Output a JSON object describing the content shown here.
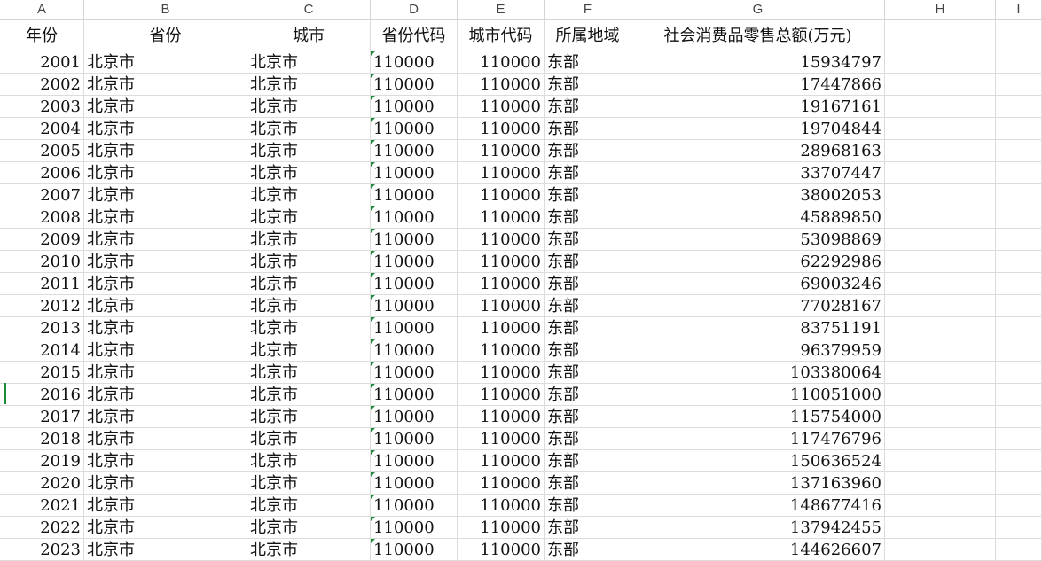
{
  "columns": [
    "A",
    "B",
    "C",
    "D",
    "E",
    "F",
    "G",
    "H",
    "I"
  ],
  "header": {
    "year": "年份",
    "province": "省份",
    "city": "城市",
    "province_code": "省份代码",
    "city_code": "城市代码",
    "region": "所属地域",
    "retail_sales": "社会消费品零售总额(万元)"
  },
  "rows": [
    {
      "year": "2001",
      "province": "北京市",
      "city": "北京市",
      "province_code": "110000",
      "city_code": "110000",
      "region": "东部",
      "retail_sales": "15934797"
    },
    {
      "year": "2002",
      "province": "北京市",
      "city": "北京市",
      "province_code": "110000",
      "city_code": "110000",
      "region": "东部",
      "retail_sales": "17447866"
    },
    {
      "year": "2003",
      "province": "北京市",
      "city": "北京市",
      "province_code": "110000",
      "city_code": "110000",
      "region": "东部",
      "retail_sales": "19167161"
    },
    {
      "year": "2004",
      "province": "北京市",
      "city": "北京市",
      "province_code": "110000",
      "city_code": "110000",
      "region": "东部",
      "retail_sales": "19704844"
    },
    {
      "year": "2005",
      "province": "北京市",
      "city": "北京市",
      "province_code": "110000",
      "city_code": "110000",
      "region": "东部",
      "retail_sales": "28968163"
    },
    {
      "year": "2006",
      "province": "北京市",
      "city": "北京市",
      "province_code": "110000",
      "city_code": "110000",
      "region": "东部",
      "retail_sales": "33707447"
    },
    {
      "year": "2007",
      "province": "北京市",
      "city": "北京市",
      "province_code": "110000",
      "city_code": "110000",
      "region": "东部",
      "retail_sales": "38002053"
    },
    {
      "year": "2008",
      "province": "北京市",
      "city": "北京市",
      "province_code": "110000",
      "city_code": "110000",
      "region": "东部",
      "retail_sales": "45889850"
    },
    {
      "year": "2009",
      "province": "北京市",
      "city": "北京市",
      "province_code": "110000",
      "city_code": "110000",
      "region": "东部",
      "retail_sales": "53098869"
    },
    {
      "year": "2010",
      "province": "北京市",
      "city": "北京市",
      "province_code": "110000",
      "city_code": "110000",
      "region": "东部",
      "retail_sales": "62292986"
    },
    {
      "year": "2011",
      "province": "北京市",
      "city": "北京市",
      "province_code": "110000",
      "city_code": "110000",
      "region": "东部",
      "retail_sales": "69003246"
    },
    {
      "year": "2012",
      "province": "北京市",
      "city": "北京市",
      "province_code": "110000",
      "city_code": "110000",
      "region": "东部",
      "retail_sales": "77028167"
    },
    {
      "year": "2013",
      "province": "北京市",
      "city": "北京市",
      "province_code": "110000",
      "city_code": "110000",
      "region": "东部",
      "retail_sales": "83751191"
    },
    {
      "year": "2014",
      "province": "北京市",
      "city": "北京市",
      "province_code": "110000",
      "city_code": "110000",
      "region": "东部",
      "retail_sales": "96379959"
    },
    {
      "year": "2015",
      "province": "北京市",
      "city": "北京市",
      "province_code": "110000",
      "city_code": "110000",
      "region": "东部",
      "retail_sales": "103380064"
    },
    {
      "year": "2016",
      "province": "北京市",
      "city": "北京市",
      "province_code": "110000",
      "city_code": "110000",
      "region": "东部",
      "retail_sales": "110051000"
    },
    {
      "year": "2017",
      "province": "北京市",
      "city": "北京市",
      "province_code": "110000",
      "city_code": "110000",
      "region": "东部",
      "retail_sales": "115754000"
    },
    {
      "year": "2018",
      "province": "北京市",
      "city": "北京市",
      "province_code": "110000",
      "city_code": "110000",
      "region": "东部",
      "retail_sales": "117476796"
    },
    {
      "year": "2019",
      "province": "北京市",
      "city": "北京市",
      "province_code": "110000",
      "city_code": "110000",
      "region": "东部",
      "retail_sales": "150636524"
    },
    {
      "year": "2020",
      "province": "北京市",
      "city": "北京市",
      "province_code": "110000",
      "city_code": "110000",
      "region": "东部",
      "retail_sales": "137163960"
    },
    {
      "year": "2021",
      "province": "北京市",
      "city": "北京市",
      "province_code": "110000",
      "city_code": "110000",
      "region": "东部",
      "retail_sales": "148677416"
    },
    {
      "year": "2022",
      "province": "北京市",
      "city": "北京市",
      "province_code": "110000",
      "city_code": "110000",
      "region": "东部",
      "retail_sales": "137942455"
    },
    {
      "year": "2023",
      "province": "北京市",
      "city": "北京市",
      "province_code": "110000",
      "city_code": "110000",
      "region": "东部",
      "retail_sales": "144626607"
    }
  ],
  "colors": {
    "grid": "#dcdcdc",
    "text_warning_triangle": "#1e8a3c",
    "selection_marker": "#1e8a3c"
  }
}
